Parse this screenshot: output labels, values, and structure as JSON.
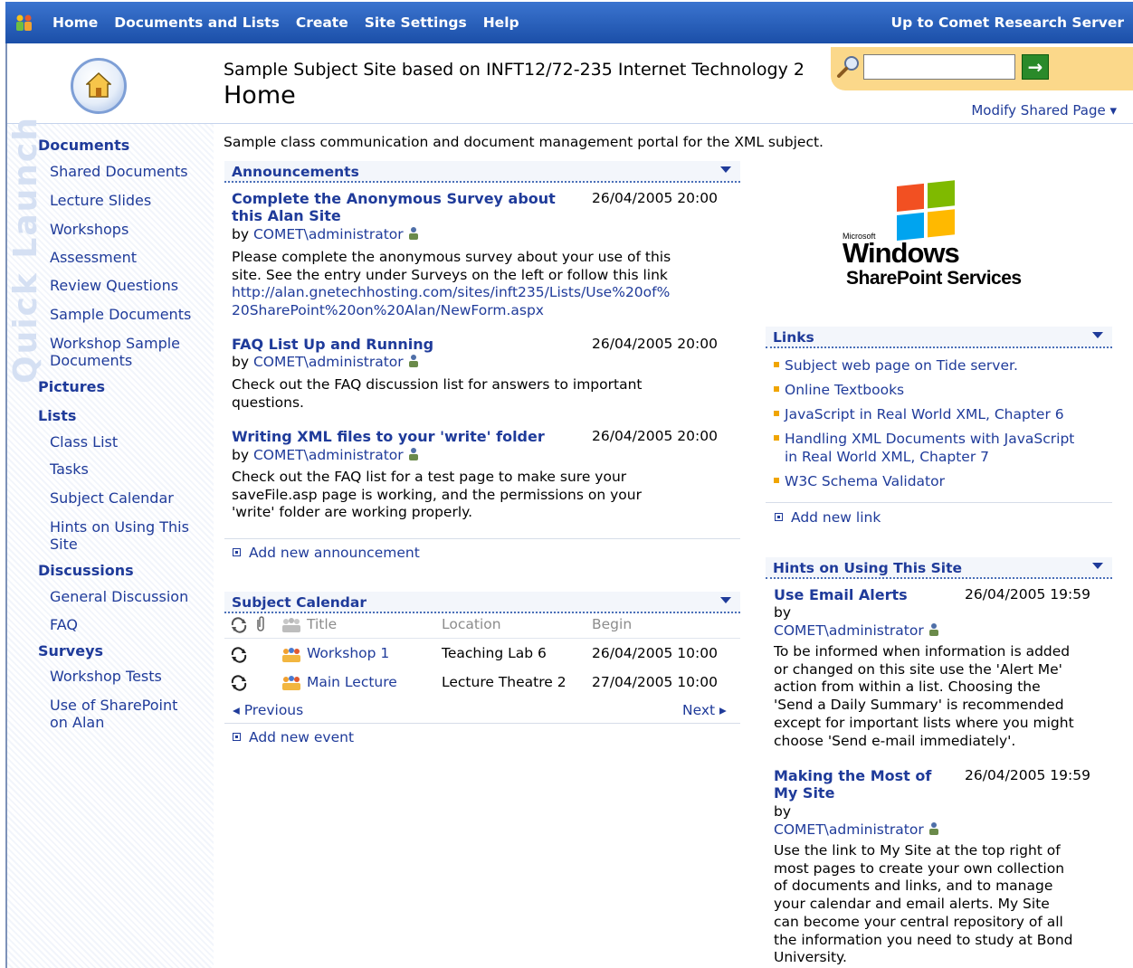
{
  "topnav": {
    "items": [
      "Home",
      "Documents and Lists",
      "Create",
      "Site Settings",
      "Help"
    ],
    "right_link": "Up to Comet Research Server"
  },
  "header": {
    "site_title": "Sample Subject Site based on INFT12/72-235 Internet Technology 2",
    "page_title": "Home",
    "search_placeholder": "",
    "go_label": "→",
    "modify_label": "Modify Shared Page ▾"
  },
  "quick_launch": {
    "watermark": "Quick Launch",
    "documents_head": "Documents",
    "documents": [
      "Shared Documents",
      "Lecture Slides",
      "Workshops",
      "Assessment",
      "Review Questions",
      "Sample Documents",
      "Workshop Sample",
      "Documents"
    ],
    "pictures_head": "Pictures",
    "lists_head": "Lists",
    "lists": [
      "Class List",
      "Tasks",
      "Subject Calendar",
      "Hints on Using This",
      "Site"
    ],
    "discussions_head": "Discussions",
    "discussions": [
      "General Discussion",
      "FAQ"
    ],
    "surveys_head": "Surveys",
    "surveys": [
      "Workshop Tests",
      "Use of SharePoint",
      "on Alan"
    ]
  },
  "main": {
    "description": "Sample class communication and document management portal for the XML subject.",
    "announcements": {
      "title": "Announcements",
      "items": [
        {
          "title_line1": "Complete the Anonymous Survey about",
          "title_line2": "this Alan Site",
          "date": "26/04/2005 20:00",
          "by": "by",
          "author": "COMET\\administrator",
          "body_lines": [
            "Please complete the anonymous survey about your use of this",
            "site. See the entry under Surveys on the left or follow this link"
          ],
          "link_lines": [
            "http://alan.gnetechhosting.com/sites/inft235/Lists/Use%20of%",
            "20SharePoint%20on%20Alan/NewForm.aspx"
          ]
        },
        {
          "title_line1": "FAQ List Up and Running",
          "date": "26/04/2005 20:00",
          "by": "by",
          "author": "COMET\\administrator",
          "body_lines": [
            "Check out the  FAQ discussion list for answers to important",
            "questions."
          ]
        },
        {
          "title_line1": "Writing XML files to your 'write' folder",
          "date": "26/04/2005 20:00",
          "by": "by",
          "author": "COMET\\administrator",
          "body_lines": [
            "Check out the FAQ list for a test page to make sure your",
            "saveFile.asp page is working, and the permissions on your",
            "'write' folder are working properly."
          ]
        }
      ],
      "add_label": "Add new announcement"
    },
    "calendar": {
      "title": "Subject Calendar",
      "columns": [
        "Title",
        "Location",
        "Begin"
      ],
      "rows": [
        {
          "title": "Workshop 1",
          "location": "Teaching Lab 6",
          "begin": "26/04/2005 10:00"
        },
        {
          "title": "Main Lecture",
          "location": "Lecture Theatre 2",
          "begin": "27/04/2005 10:00"
        }
      ],
      "previous": "◂ Previous",
      "next": "Next ▸",
      "add_label": "Add new event"
    }
  },
  "right": {
    "logo_text_small": "Microsoft",
    "logo_text_windows": "Windows",
    "logo_text_sp": "SharePoint Services",
    "links": {
      "title": "Links",
      "items": [
        "Subject web page on Tide server.",
        "Online Textbooks",
        "JavaScript in Real World XML, Chapter 6",
        "Handling XML Documents with JavaScript",
        "in Real World XML, Chapter 7",
        "W3C Schema Validator"
      ],
      "add_label": "Add new link"
    },
    "hints": {
      "title": "Hints on Using This Site",
      "items": [
        {
          "title_line1": "Use Email Alerts",
          "date": "26/04/2005 19:59",
          "by": "by",
          "author": "COMET\\administrator",
          "body_lines": [
            "To be informed when information is added",
            "or changed on this site use the 'Alert Me'",
            "action from within a list. Choosing the",
            "'Send a Daily Summary' is recommended",
            "except for important lists where you might",
            "choose 'Send e-mail immediately'."
          ]
        },
        {
          "title_line1": "Making the Most of",
          "title_line2": "My Site",
          "date": "26/04/2005 19:59",
          "by": "by",
          "author": "COMET\\administrator",
          "body_lines": [
            "Use the link to My Site at the top right of",
            "most pages to create your own collection",
            "of documents and links, and to manage",
            "your calendar and email alerts. My Site",
            "can become your central repository of all",
            "the information you need to study at Bond",
            "University."
          ]
        }
      ]
    }
  },
  "colors": {
    "nav_blue": "#1b4fa8",
    "link_blue": "#1f3b9a",
    "search_orange": "#fbd88a",
    "bullet_orange": "#f0a500"
  }
}
